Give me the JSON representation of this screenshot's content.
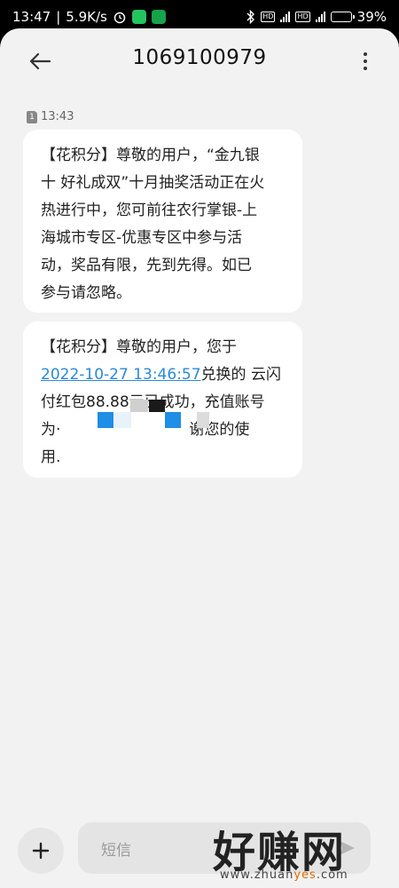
{
  "status_bar": {
    "time": "13:47",
    "network_speed": "5.9K/s",
    "battery_percent": "39%",
    "battery_level": 0.39,
    "icons": [
      "alarm-icon",
      "wechat-icon",
      "app-shield-icon",
      "bluetooth-icon",
      "hd-icon",
      "signal-4g-icon",
      "battery-icon"
    ]
  },
  "header": {
    "title": "1069100979",
    "back_icon": "arrow-left-icon",
    "menu_icon": "more-vertical-icon"
  },
  "conversation": {
    "sim_label": "1",
    "timestamp": "13:43",
    "messages": [
      {
        "lines": [
          "【花积分】尊敬的用户，“金九银",
          "十 好礼成双”十月抽奖活动正在火",
          "热进行中，您可前往农行掌银-上",
          "海城市专区-优惠专区中参与活",
          "动，奖品有限，先到先得。如已",
          "参与请忽略。"
        ]
      },
      {
        "line1": "【花积分】尊敬的用户，您于",
        "link_text": "2022-10-27 13:46:57",
        "line2_rest": "兑换的 云闪",
        "line3": "付红包88.88元已成功，充值账号",
        "line4_start": "为·",
        "line4_end": "谢您的使",
        "line5": "用."
      }
    ]
  },
  "composer": {
    "placeholder": "短信",
    "add_icon": "plus-icon",
    "send_icon": "send-icon"
  },
  "watermark": {
    "title": "好赚网",
    "site_prefix": "www.zhuan",
    "site_highlight": "yes",
    "site_suffix": ".com"
  },
  "colors": {
    "background": "#f2f2f2",
    "bubble": "#ffffff",
    "link": "#2a8ad8",
    "mask_blue": "#1e8ee6"
  }
}
